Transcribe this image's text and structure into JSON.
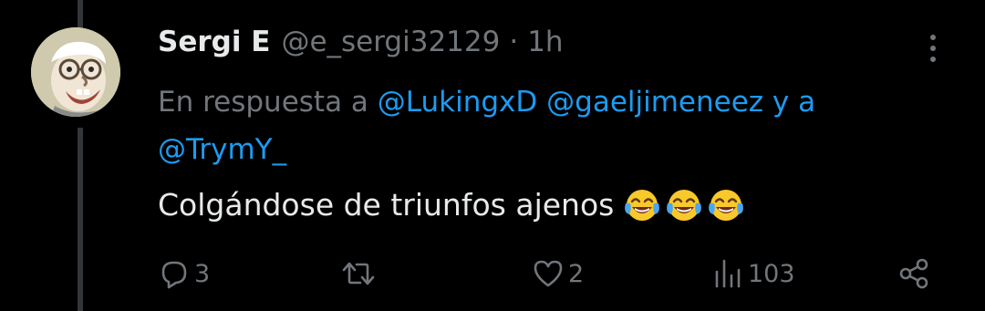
{
  "tweet": {
    "display_name": "Sergi E",
    "handle": "@e_sergi32129",
    "separator": "·",
    "time": "1h",
    "reply_prefix": "En respuesta a",
    "mention_1": "@LukingxD",
    "mention_2": "@gaeljimeneez",
    "reply_connector": "y a",
    "mention_3": "@TrymY_",
    "text": "Colgándose de triunfos ajenos",
    "emoji_icon": "face-with-tears-of-joy-icon",
    "emoji_count": 3
  },
  "actions": {
    "reply_count": "3",
    "retweet_count": "",
    "like_count": "2",
    "view_count": "103"
  },
  "colors": {
    "background": "#000000",
    "primary_text": "#e7e9ea",
    "secondary_text": "#71767b",
    "accent": "#1d9bf0"
  }
}
